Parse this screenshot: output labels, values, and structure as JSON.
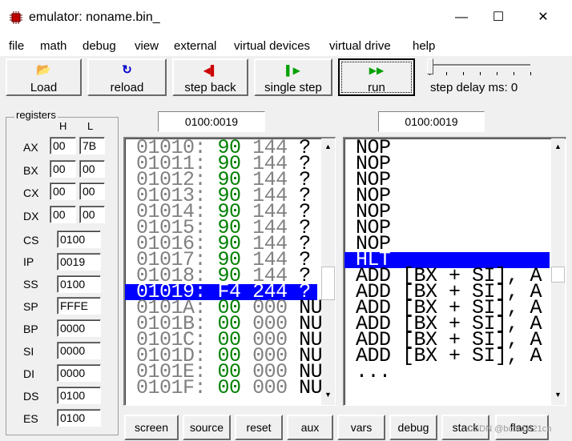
{
  "window": {
    "title": "emulator: noname.bin_",
    "minimize": "—",
    "maximize": "☐",
    "close": "✕"
  },
  "menu": [
    "file",
    "math",
    "debug",
    "view",
    "external",
    "virtual devices",
    "virtual drive",
    "help"
  ],
  "toolbar": {
    "load": {
      "label": "Load",
      "icon": "open-folder-icon",
      "glyph": "📂"
    },
    "reload": {
      "label": "reload",
      "icon": "reload-icon",
      "glyph": "↻"
    },
    "step_back": {
      "label": "step back",
      "icon": "step-back-icon",
      "glyph": "◀▌"
    },
    "single_step": {
      "label": "single step",
      "icon": "single-step-icon",
      "glyph": "▌▶"
    },
    "run": {
      "label": "run",
      "icon": "run-icon",
      "glyph": "▶▶"
    },
    "step_delay": "step delay ms: 0",
    "step_delay_value": 0
  },
  "registers": {
    "title": "registers",
    "h_label": "H",
    "l_label": "L",
    "general": [
      {
        "name": "AX",
        "h": "00",
        "l": "7B"
      },
      {
        "name": "BX",
        "h": "00",
        "l": "00"
      },
      {
        "name": "CX",
        "h": "00",
        "l": "00"
      },
      {
        "name": "DX",
        "h": "00",
        "l": "00"
      }
    ],
    "segment": [
      {
        "name": "CS",
        "value": "0100"
      },
      {
        "name": "IP",
        "value": "0019"
      },
      {
        "name": "SS",
        "value": "0100"
      },
      {
        "name": "SP",
        "value": "FFFE"
      },
      {
        "name": "BP",
        "value": "0000"
      },
      {
        "name": "SI",
        "value": "0000"
      },
      {
        "name": "DI",
        "value": "0000"
      },
      {
        "name": "DS",
        "value": "0100"
      },
      {
        "name": "ES",
        "value": "0100"
      }
    ]
  },
  "memory": {
    "address": "0100:0019",
    "rows": [
      {
        "addr": "01010:",
        "hex": "90",
        "dec": "144",
        "ch": "?"
      },
      {
        "addr": "01011:",
        "hex": "90",
        "dec": "144",
        "ch": "?"
      },
      {
        "addr": "01012:",
        "hex": "90",
        "dec": "144",
        "ch": "?"
      },
      {
        "addr": "01013:",
        "hex": "90",
        "dec": "144",
        "ch": "?"
      },
      {
        "addr": "01014:",
        "hex": "90",
        "dec": "144",
        "ch": "?"
      },
      {
        "addr": "01015:",
        "hex": "90",
        "dec": "144",
        "ch": "?"
      },
      {
        "addr": "01016:",
        "hex": "90",
        "dec": "144",
        "ch": "?"
      },
      {
        "addr": "01017:",
        "hex": "90",
        "dec": "144",
        "ch": "?"
      },
      {
        "addr": "01018:",
        "hex": "90",
        "dec": "144",
        "ch": "?"
      },
      {
        "addr": "01019:",
        "hex": "F4",
        "dec": "244",
        "ch": "?",
        "selected": true
      },
      {
        "addr": "0101A:",
        "hex": "00",
        "dec": "000",
        "ch": "NU"
      },
      {
        "addr": "0101B:",
        "hex": "00",
        "dec": "000",
        "ch": "NU"
      },
      {
        "addr": "0101C:",
        "hex": "00",
        "dec": "000",
        "ch": "NU"
      },
      {
        "addr": "0101D:",
        "hex": "00",
        "dec": "000",
        "ch": "NU"
      },
      {
        "addr": "0101E:",
        "hex": "00",
        "dec": "000",
        "ch": "NU"
      },
      {
        "addr": "0101F:",
        "hex": "00",
        "dec": "000",
        "ch": "NU"
      }
    ]
  },
  "disasm": {
    "address": "0100:0019",
    "rows": [
      {
        "text": "NOP"
      },
      {
        "text": "NOP"
      },
      {
        "text": "NOP"
      },
      {
        "text": "NOP"
      },
      {
        "text": "NOP"
      },
      {
        "text": "NOP"
      },
      {
        "text": "NOP"
      },
      {
        "text": "HLT",
        "selected": true
      },
      {
        "text": "ADD [BX + SI], A"
      },
      {
        "text": "ADD [BX + SI], A"
      },
      {
        "text": "ADD [BX + SI], A"
      },
      {
        "text": "ADD [BX + SI], A"
      },
      {
        "text": "ADD [BX + SI], A"
      },
      {
        "text": "ADD [BX + SI], A"
      },
      {
        "text": "..."
      }
    ]
  },
  "bottom_buttons": [
    "screen",
    "source",
    "reset",
    "aux",
    "vars",
    "debug",
    "stack",
    "flags"
  ],
  "scroll": {
    "up": "▲",
    "down": "▼"
  },
  "watermark": "CSDN @bcbobo21cn",
  "colors": {
    "selection": "#0000ff",
    "hex_values": "#008000",
    "address_text": "#808080"
  }
}
